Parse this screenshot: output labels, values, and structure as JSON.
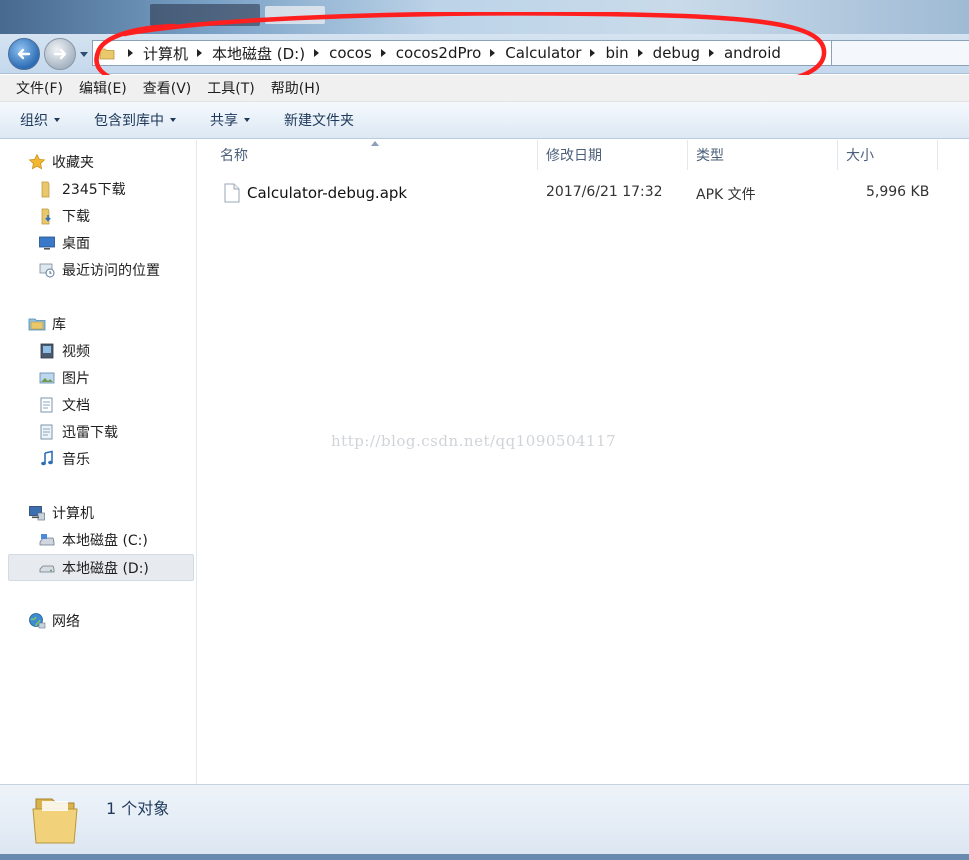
{
  "breadcrumb": [
    "计算机",
    "本地磁盘 (D:)",
    "cocos",
    "cocos2dPro",
    "Calculator",
    "bin",
    "debug",
    "android"
  ],
  "menu": [
    "文件(F)",
    "编辑(E)",
    "查看(V)",
    "工具(T)",
    "帮助(H)"
  ],
  "toolbar": {
    "organize": "组织",
    "include_library": "包含到库中",
    "share": "共享",
    "new_folder": "新建文件夹"
  },
  "nav": {
    "favorites": "收藏夹",
    "fav_2345": "2345下载",
    "fav_downloads": "下载",
    "fav_desktop": "桌面",
    "fav_recent": "最近访问的位置",
    "libraries": "库",
    "lib_video": "视频",
    "lib_pictures": "图片",
    "lib_documents": "文档",
    "lib_thunder": "迅雷下载",
    "lib_music": "音乐",
    "computer": "计算机",
    "drive_c": "本地磁盘 (C:)",
    "drive_d": "本地磁盘 (D:)",
    "network": "网络"
  },
  "columns": {
    "name": "名称",
    "modified": "修改日期",
    "type": "类型",
    "size": "大小"
  },
  "files": [
    {
      "name": "Calculator-debug.apk",
      "modified": "2017/6/21 17:32",
      "type": "APK 文件",
      "size": "5,996 KB"
    }
  ],
  "watermark": "http://blog.csdn.net/qq1090504117",
  "status": {
    "item_count": "1 个对象"
  },
  "colors": {
    "annotation": "#ff1f1f",
    "accent": "#1e395b"
  }
}
